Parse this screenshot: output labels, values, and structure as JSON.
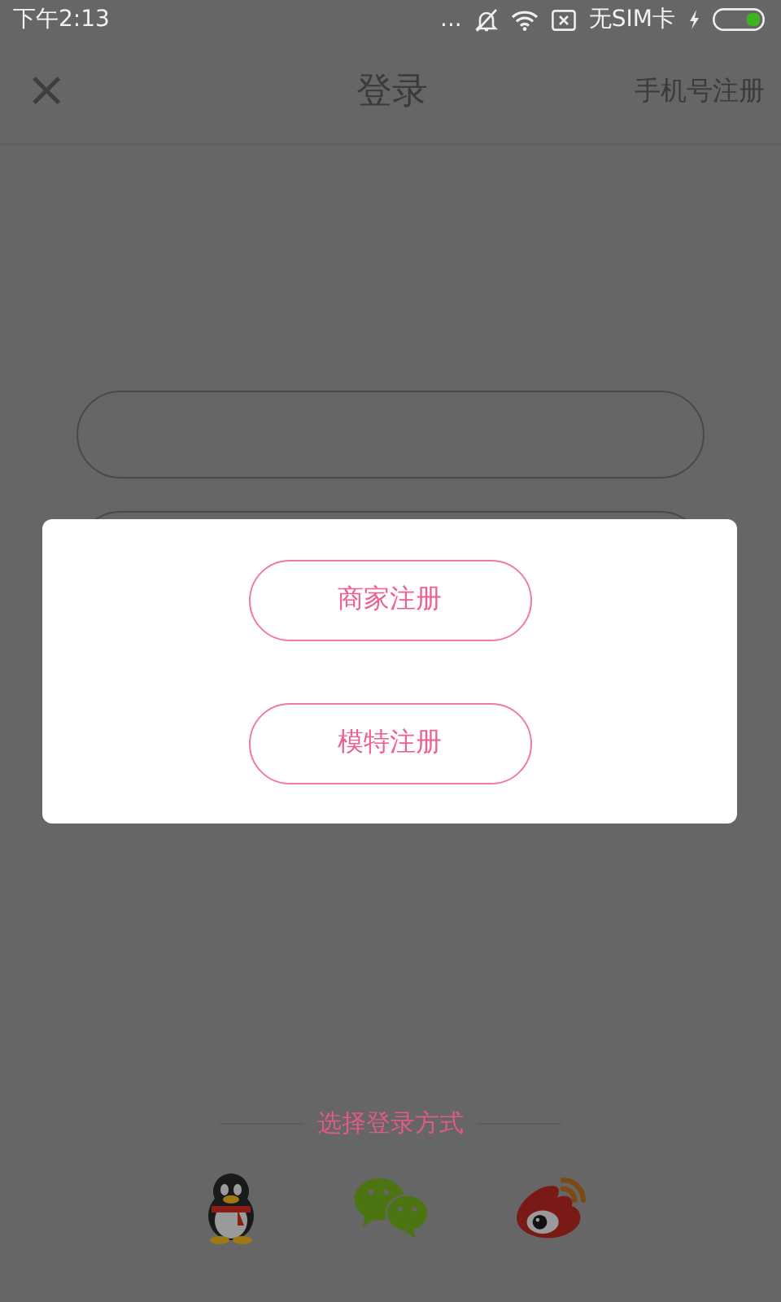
{
  "status_bar": {
    "time": "下午2:13",
    "more": "...",
    "carrier": "无SIM卡"
  },
  "header": {
    "close": "×",
    "title": "登录",
    "action": "手机号注册"
  },
  "dialog": {
    "buttons": [
      "商家注册",
      "模特注册"
    ]
  },
  "login_options": {
    "label": "选择登录方式"
  }
}
